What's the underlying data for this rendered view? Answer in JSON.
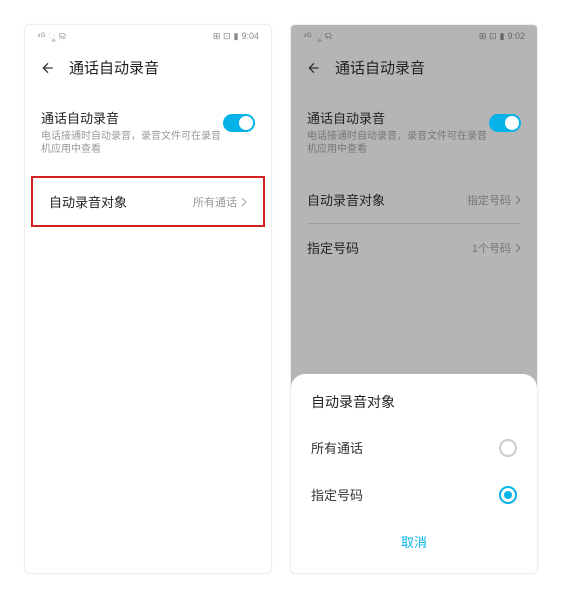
{
  "left": {
    "status_time": "9:04",
    "page_title": "通话自动录音",
    "auto_record": {
      "label": "通话自动录音",
      "desc": "电话接通时自动录音，录音文件可在录音机应用中查看"
    },
    "target_row": {
      "label": "自动录音对象",
      "value": "所有通话"
    }
  },
  "right": {
    "status_time": "9:02",
    "page_title": "通话自动录音",
    "auto_record": {
      "label": "通话自动录音",
      "desc": "电话接通时自动录音，录音文件可在录音机应用中查看"
    },
    "target_row": {
      "label": "自动录音对象",
      "value": "指定号码"
    },
    "number_row": {
      "label": "指定号码",
      "value": "1个号码"
    },
    "sheet": {
      "title": "自动录音对象",
      "option1": "所有通话",
      "option2": "指定号码",
      "cancel": "取消"
    }
  }
}
